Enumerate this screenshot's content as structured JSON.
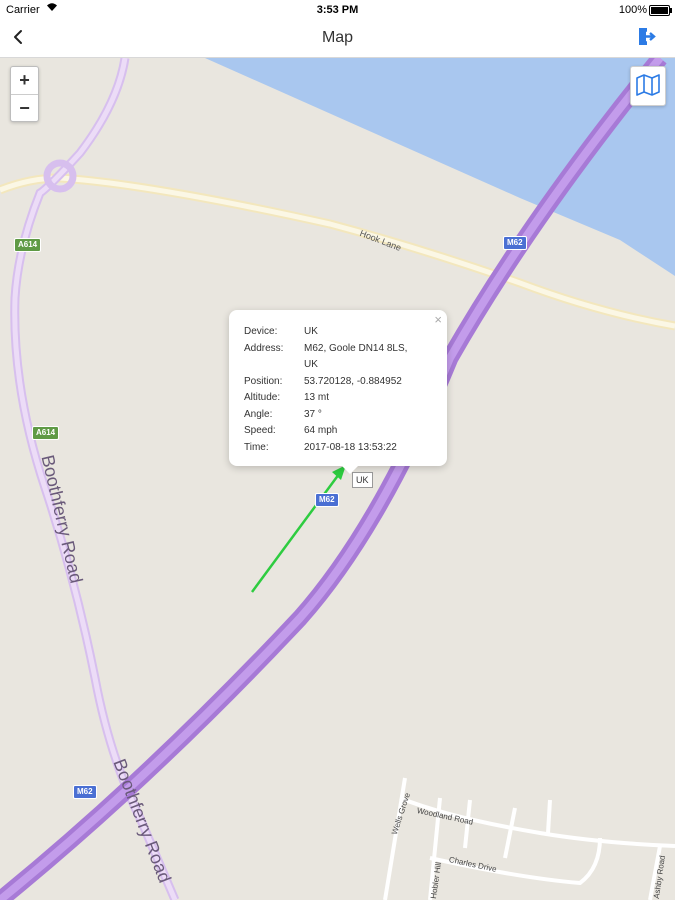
{
  "status_bar": {
    "carrier": "Carrier",
    "time": "3:53 PM",
    "battery": "100%"
  },
  "nav": {
    "title": "Map"
  },
  "map": {
    "zoom_in": "+",
    "zoom_out": "−",
    "shields": {
      "m62_top": "M62",
      "m62_mid": "M62",
      "m62_low": "M62",
      "a614_top": "A614",
      "a614_mid": "A614"
    },
    "road_labels": {
      "hook_lane": "Hook Lane",
      "boothferry_upper": "Boothferry Road",
      "boothferry_lower": "Boothferry Road",
      "wells_grove": "Wells Grove",
      "woodland_road": "Woodland Road",
      "charles_drive": "Charles Drive",
      "hobler_hill": "Hobler Hill",
      "street_right": "Ashby Road"
    },
    "marker_label": "UK",
    "colors": {
      "water": "#a9c7ef",
      "motorway": "#b57fe0",
      "primary_road": "#ddc5f0",
      "minor_road": "#f6eec5",
      "track": "#2ecc40"
    }
  },
  "popup": {
    "close": "×",
    "rows": [
      {
        "label": "Device:",
        "value": "UK"
      },
      {
        "label": "Address:",
        "value": "M62, Goole DN14 8LS, UK"
      },
      {
        "label": "Position:",
        "value": "53.720128, -0.884952"
      },
      {
        "label": "Altitude:",
        "value": "13 mt"
      },
      {
        "label": "Angle:",
        "value": "37 °"
      },
      {
        "label": "Speed:",
        "value": "64 mph"
      },
      {
        "label": "Time:",
        "value": "2017-08-18 13:53:22"
      }
    ]
  }
}
